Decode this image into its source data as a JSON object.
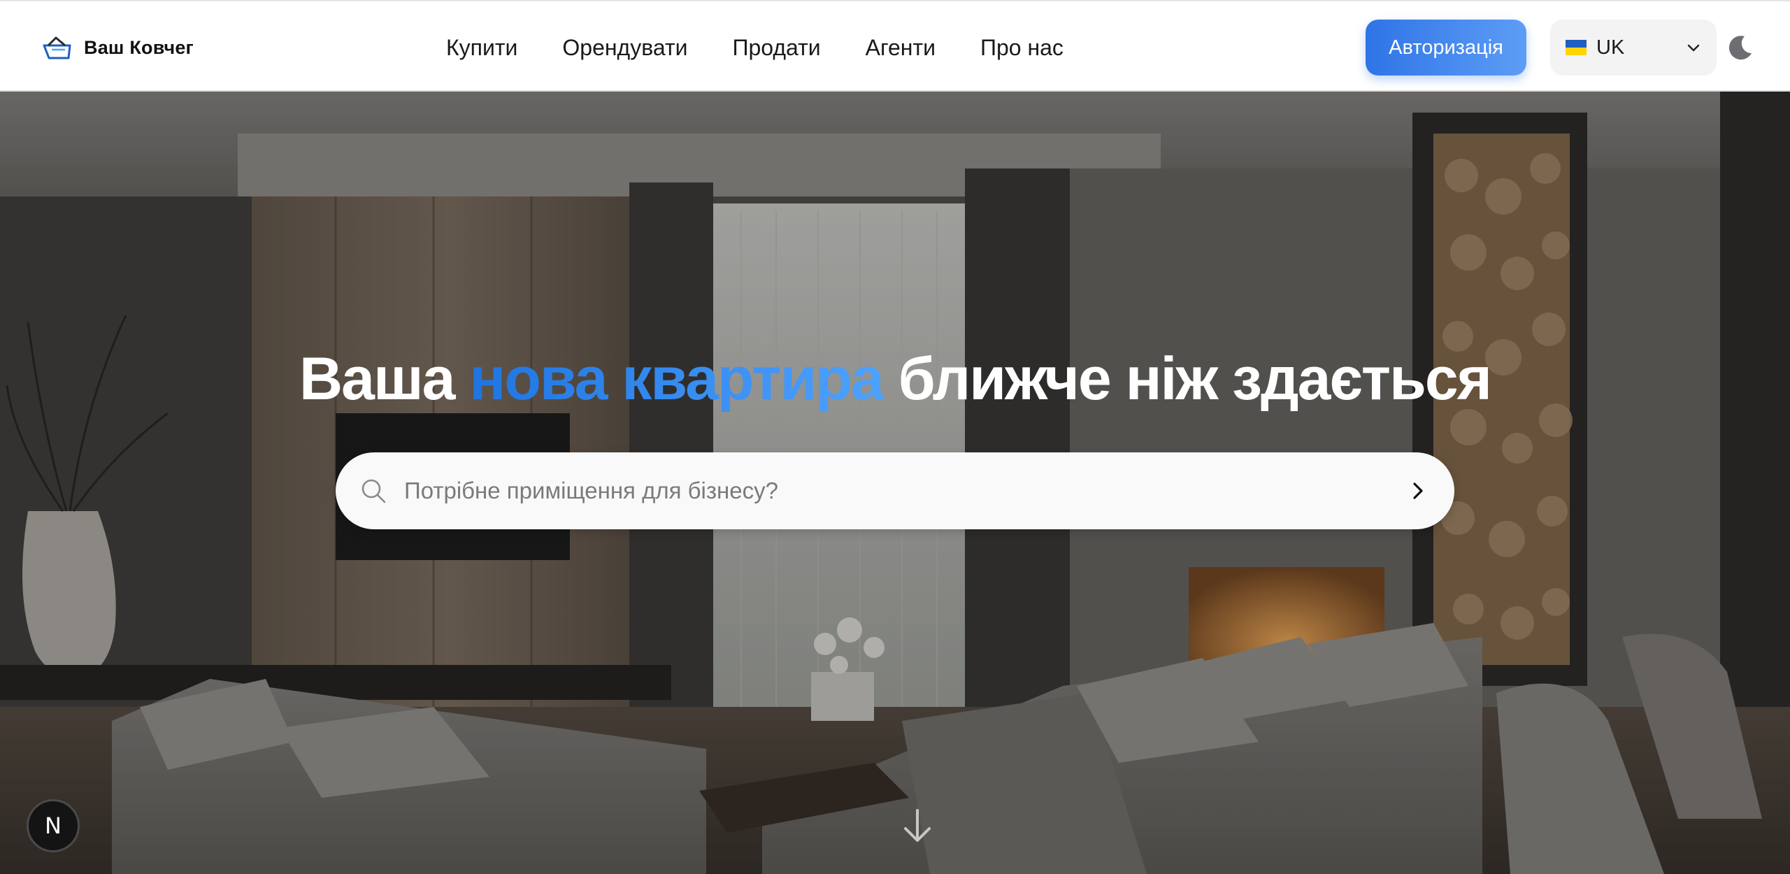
{
  "header": {
    "logo_text": "Ваш Ковчег",
    "nav": [
      "Купити",
      "Орендувати",
      "Продати",
      "Агенти",
      "Про нас"
    ],
    "auth_label": "Авторизація",
    "language": {
      "code": "UK",
      "flag": "ukraine-flag-icon"
    },
    "theme_icon": "moon-icon"
  },
  "hero": {
    "headline": {
      "before": "Ваша",
      "accent": "нова квартира",
      "after": "ближче ніж здається"
    },
    "search": {
      "placeholder": "Потрібне приміщення для бізнесу?",
      "value": ""
    },
    "scroll_icon": "arrow-down-icon",
    "dev_badge": "N"
  },
  "colors": {
    "accent_start": "#1f74e0",
    "accent_end": "#4ea2ff",
    "button_start": "#2f74e6",
    "button_end": "#5d9df6"
  }
}
